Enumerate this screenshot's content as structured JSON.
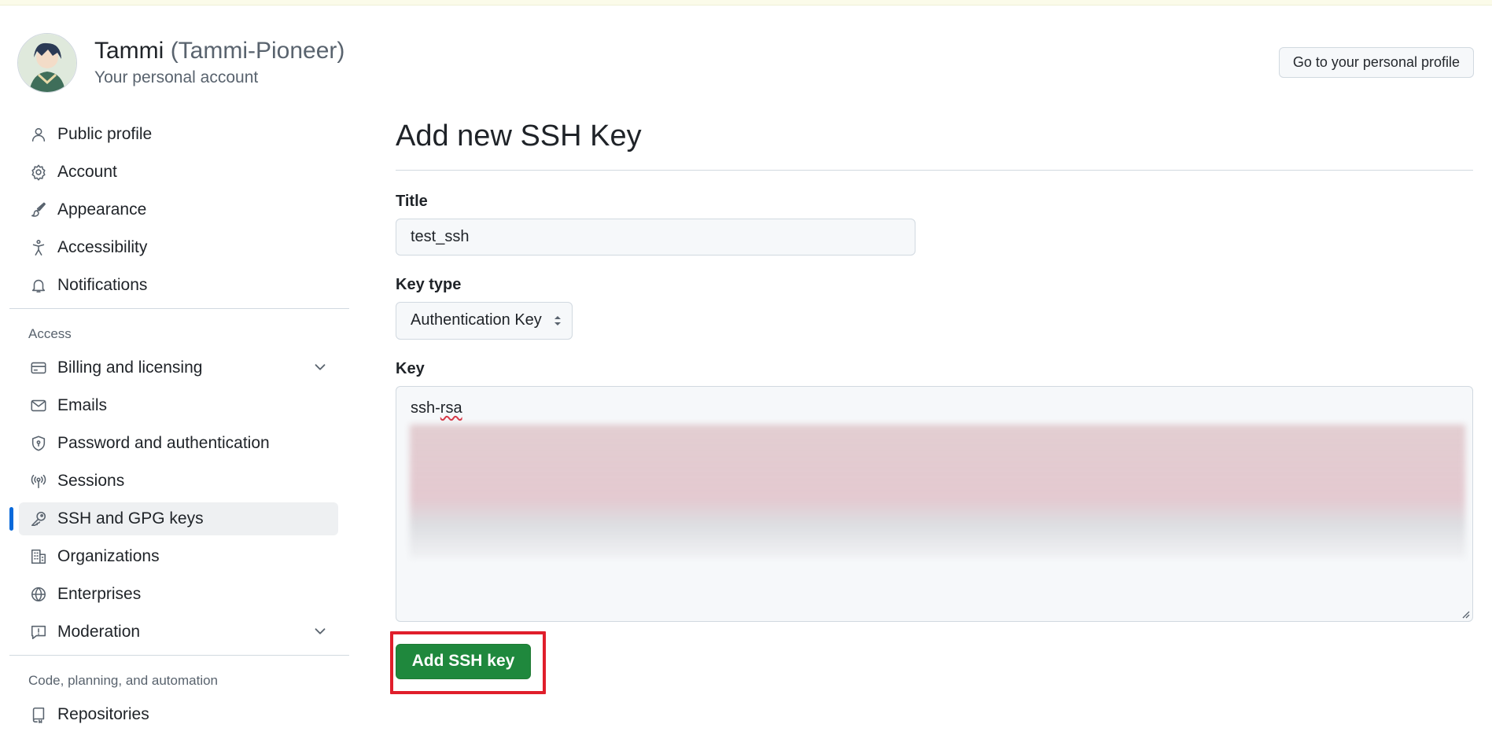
{
  "header": {
    "display_name": "Tammi",
    "username": "(Tammi-Pioneer)",
    "subtitle": "Your personal account",
    "profile_button": "Go to your personal profile"
  },
  "sidebar": {
    "items_top": [
      {
        "label": "Public profile",
        "icon": "person-icon"
      },
      {
        "label": "Account",
        "icon": "gear-icon"
      },
      {
        "label": "Appearance",
        "icon": "paintbrush-icon"
      },
      {
        "label": "Accessibility",
        "icon": "accessibility-icon"
      },
      {
        "label": "Notifications",
        "icon": "bell-icon"
      }
    ],
    "section_access": "Access",
    "items_access": [
      {
        "label": "Billing and licensing",
        "icon": "credit-card-icon",
        "expandable": true
      },
      {
        "label": "Emails",
        "icon": "mail-icon"
      },
      {
        "label": "Password and authentication",
        "icon": "shield-lock-icon"
      },
      {
        "label": "Sessions",
        "icon": "broadcast-icon"
      },
      {
        "label": "SSH and GPG keys",
        "icon": "key-icon",
        "active": true
      },
      {
        "label": "Organizations",
        "icon": "organization-icon"
      },
      {
        "label": "Enterprises",
        "icon": "globe-icon"
      },
      {
        "label": "Moderation",
        "icon": "report-icon",
        "expandable": true
      }
    ],
    "section_code": "Code, planning, and automation",
    "items_code": [
      {
        "label": "Repositories",
        "icon": "repo-icon"
      }
    ]
  },
  "form": {
    "heading": "Add new SSH Key",
    "title_label": "Title",
    "title_value": "test_ssh",
    "key_type_label": "Key type",
    "key_type_value": "Authentication Key",
    "key_label": "Key",
    "key_prefix": "ssh-",
    "key_prefix_flagged": "rsa",
    "submit_label": "Add SSH key"
  },
  "colors": {
    "accent": "#0969da",
    "primary_button": "#1f883d",
    "highlight_frame": "#e01e2b"
  }
}
